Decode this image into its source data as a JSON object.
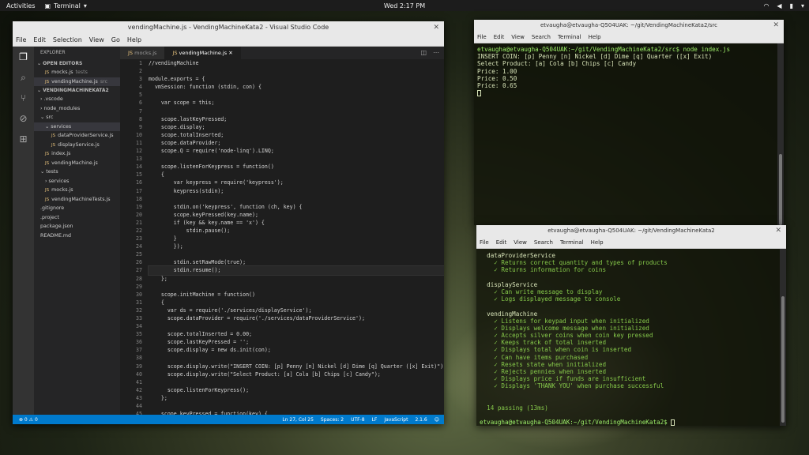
{
  "topbar": {
    "activities": "Activities",
    "app": "Terminal",
    "clock": "Wed  2:17 PM"
  },
  "vscode": {
    "title": "vendingMachine.js - VendingMachineKata2 - Visual Studio Code",
    "menu": [
      "File",
      "Edit",
      "Selection",
      "View",
      "Go",
      "Help"
    ],
    "explorer": {
      "header": "EXPLORER",
      "open_editors": "OPEN EDITORS",
      "open_files": [
        {
          "name": "mocks.js",
          "sub": "tests"
        },
        {
          "name": "vendingMachine.js",
          "sub": "src"
        }
      ],
      "project": "VENDINGMACHINEKATA2",
      "tree": [
        {
          "label": "› .vscode",
          "indent": 8
        },
        {
          "label": "› node_modules",
          "indent": 8
        },
        {
          "label": "⌄ src",
          "indent": 8
        },
        {
          "label": "⌄ services",
          "indent": 14,
          "selected": true
        },
        {
          "label": "dataProviderService.js",
          "indent": 22,
          "js": true
        },
        {
          "label": "displayService.js",
          "indent": 22,
          "js": true
        },
        {
          "label": "index.js",
          "indent": 14,
          "js": true
        },
        {
          "label": "vendingMachine.js",
          "indent": 14,
          "js": true
        },
        {
          "label": "⌄ tests",
          "indent": 8
        },
        {
          "label": "› services",
          "indent": 14
        },
        {
          "label": "mocks.js",
          "indent": 14,
          "js": true
        },
        {
          "label": "vendingMachineTests.js",
          "indent": 14,
          "js": true
        },
        {
          "label": ".gitignore",
          "indent": 8
        },
        {
          "label": ".project",
          "indent": 8
        },
        {
          "label": "package.json",
          "indent": 8
        },
        {
          "label": "README.md",
          "indent": 8
        }
      ]
    },
    "tabs": [
      {
        "label": "mocks.js"
      },
      {
        "label": "vendingMachine.js",
        "active": true
      }
    ],
    "code_lines": [
      "//vendingMachine",
      "",
      "module.exports = {",
      "  vmSession: function (stdin, con) {",
      "",
      "    var scope = this;",
      "",
      "    scope.lastKeyPressed;",
      "    scope.display;",
      "    scope.totalInserted;",
      "    scope.dataProvider;",
      "    scope.Q = require('node-linq').LINQ;",
      "",
      "    scope.listenForKeypress = function()",
      "    {",
      "        var keypress = require('keypress');",
      "        keypress(stdin);",
      "",
      "        stdin.on('keypress', function (ch, key) {",
      "        scope.keyPressed(key.name);",
      "        if (key && key.name == 'x') {",
      "            stdin.pause();",
      "        }",
      "        });",
      "",
      "        stdin.setRawMode(true);",
      "        stdin.resume();",
      "    };",
      "",
      "    scope.initMachine = function()",
      "    {",
      "      var ds = require('./services/displayService');",
      "      scope.dataProvider = require('./services/dataProviderService');",
      "",
      "      scope.totalInserted = 0.00;",
      "      scope.lastKeyPressed = '';",
      "      scope.display = new ds.init(con);",
      "",
      "      scope.display.write(\"INSERT COIN: [p] Penny [n] Nickel [d] Dime [q] Quarter ([x] Exit)\");",
      "      scope.display.write(\"Select Product: [a] Cola [b] Chips [c] Candy\");",
      "",
      "      scope.listenForKeypress();",
      "    };",
      "",
      "    scope.keyPressed = function(key) {"
    ],
    "status": {
      "left": "⊗ 0  ⚠ 0",
      "items": [
        "Ln 27, Col 25",
        "Spaces: 2",
        "UTF-8",
        "LF",
        "JavaScript",
        "2.1.6",
        "☺"
      ]
    }
  },
  "term1": {
    "title": "etvaugha@etvaugha-Q504UAK: ~/git/VendingMachineKata2/src",
    "menu": [
      "File",
      "Edit",
      "View",
      "Search",
      "Terminal",
      "Help"
    ],
    "lines": [
      {
        "t": "etvaugha@etvaugha-Q504UAK:~/git/VendingMachineKata2/src$ node index.js",
        "c": "prompt"
      },
      {
        "t": "INSERT COIN: [p] Penny [n] Nickel [d] Dime [q] Quarter ([x] Exit)",
        "c": ""
      },
      {
        "t": "Select Product: [a] Cola [b] Chips [c] Candy",
        "c": ""
      },
      {
        "t": "Price: 1.00",
        "c": ""
      },
      {
        "t": "Price: 0.50",
        "c": ""
      },
      {
        "t": "Price: 0.65",
        "c": ""
      }
    ]
  },
  "term2": {
    "title": "etvaugha@etvaugha-Q504UAK: ~/git/VendingMachineKata2",
    "menu": [
      "File",
      "Edit",
      "View",
      "Search",
      "Terminal",
      "Help"
    ],
    "lines": [
      {
        "t": "  dataProviderService",
        "c": ""
      },
      {
        "t": "    ✓ Returns correct quantity and types of products",
        "c": "ok"
      },
      {
        "t": "    ✓ Returns information for coins",
        "c": "ok"
      },
      {
        "t": "",
        "c": ""
      },
      {
        "t": "  displayService",
        "c": ""
      },
      {
        "t": "    ✓ Can write message to display",
        "c": "ok"
      },
      {
        "t": "    ✓ Logs displayed message to console",
        "c": "ok"
      },
      {
        "t": "",
        "c": ""
      },
      {
        "t": "  vendingMachine",
        "c": ""
      },
      {
        "t": "    ✓ Listens for keypad input when initialized",
        "c": "ok"
      },
      {
        "t": "    ✓ Displays welcome message when initialized",
        "c": "ok"
      },
      {
        "t": "    ✓ Accepts silver coins when coin key pressed",
        "c": "ok"
      },
      {
        "t": "    ✓ Keeps track of total inserted",
        "c": "ok"
      },
      {
        "t": "    ✓ Displays total when coin is inserted",
        "c": "ok"
      },
      {
        "t": "    ✓ Can have items purchased",
        "c": "ok"
      },
      {
        "t": "    ✓ Resets state when initialized",
        "c": "ok"
      },
      {
        "t": "    ✓ Rejects pennies when inserted",
        "c": "ok"
      },
      {
        "t": "    ✓ Displays price if funds are insufficient",
        "c": "ok"
      },
      {
        "t": "    ✓ Displays 'THANK YOU' when purchase successful",
        "c": "ok"
      },
      {
        "t": "",
        "c": ""
      },
      {
        "t": "",
        "c": ""
      },
      {
        "t": "  14 passing (13ms)",
        "c": "ok"
      },
      {
        "t": "",
        "c": ""
      },
      {
        "t": "etvaugha@etvaugha-Q504UAK:~/git/VendingMachineKata2$ ",
        "c": "prompt"
      }
    ]
  }
}
